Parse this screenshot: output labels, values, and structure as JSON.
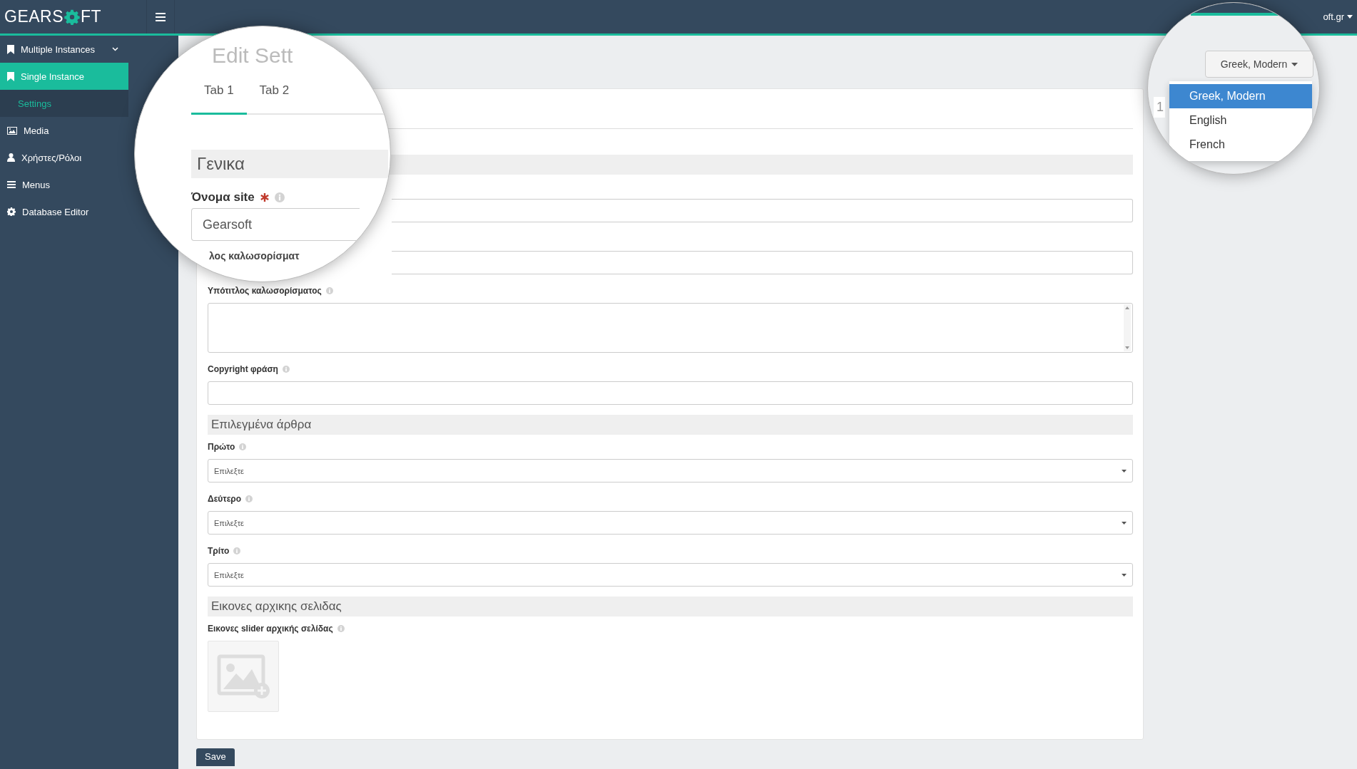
{
  "brand": {
    "left": "GEARS",
    "right": "FT"
  },
  "topbar": {
    "user": "oft.gr"
  },
  "sidebar": {
    "items": [
      {
        "label": "Multiple Instances",
        "selected": false,
        "expandable": true
      },
      {
        "label": "Single Instance",
        "selected": true,
        "children": [
          {
            "label": "Settings",
            "selected": true
          }
        ]
      },
      {
        "label": "Media",
        "selected": false
      },
      {
        "label": "Χρήστες/Ρόλοι",
        "selected": false
      },
      {
        "label": "Menus",
        "selected": false
      },
      {
        "label": "Database Editor",
        "selected": false
      }
    ]
  },
  "form": {
    "items": [
      {
        "kind": "section"
      },
      {
        "kind": "input"
      },
      {
        "kind": "input"
      },
      {
        "kind": "textarea",
        "label": "Υπότιτλος καλωσορίσματος"
      },
      {
        "kind": "input",
        "label": "Copyright φράση"
      },
      {
        "kind": "section",
        "title": "Επιλεγμένα άρθρα"
      },
      {
        "kind": "select",
        "label": "Πρώτο",
        "value": "Επιλεξτε"
      },
      {
        "kind": "select",
        "label": "Δεύτερο",
        "value": "Επιλεξτε"
      },
      {
        "kind": "select",
        "label": "Τρίτο",
        "value": "Επιλεξτε"
      },
      {
        "kind": "section",
        "title": "Εικονες αρχικης σελιδας"
      },
      {
        "kind": "images",
        "label": "Εικονες slider αρχικής σελίδας"
      }
    ]
  },
  "save": "Save",
  "magnifier_left": {
    "title": "Edit Sett",
    "tabs": [
      {
        "label": "Tab 1",
        "selected": true
      },
      {
        "label": "Tab 2",
        "selected": false
      }
    ],
    "section": "Γενικα",
    "field": {
      "label": "Όνομα site",
      "required": true,
      "value": "Gearsoft"
    },
    "next_label": "λος καλωσορίσματ"
  },
  "magnifier_right": {
    "button": "Greek, Modern",
    "options": [
      {
        "label": "Greek, Modern",
        "selected": true
      },
      {
        "label": "English",
        "selected": false
      },
      {
        "label": "French",
        "selected": false
      }
    ],
    "page_number": "1"
  }
}
